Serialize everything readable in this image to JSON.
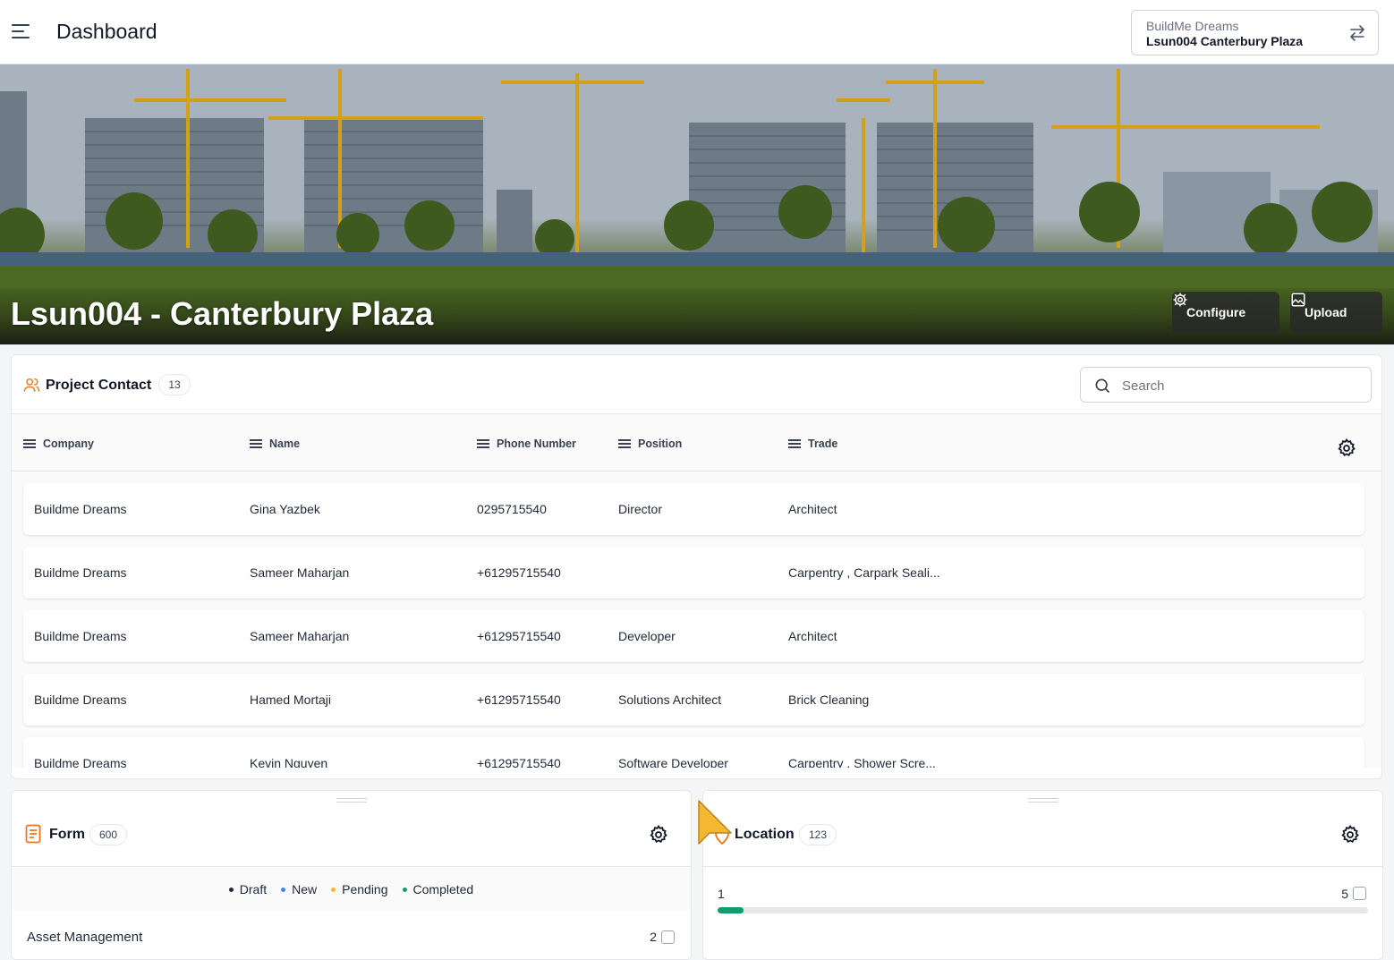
{
  "header": {
    "title": "Dashboard",
    "project_switcher": {
      "organization": "BuildMe Dreams",
      "project": "Lsun004 Canterbury Plaza"
    }
  },
  "banner": {
    "title": "Lsun004 - Canterbury Plaza",
    "configure_label": "Configure",
    "upload_label": "Upload"
  },
  "contacts": {
    "title": "Project Contact",
    "count": "13",
    "search_placeholder": "Search",
    "columns": [
      "Company",
      "Name",
      "Phone Number",
      "Position",
      "Trade"
    ],
    "rows": [
      {
        "company": "Buildme Dreams",
        "name": "Gina Yazbek",
        "phone": "0295715540",
        "position": "Director",
        "trade": "Architect"
      },
      {
        "company": "Buildme Dreams",
        "name": "Sameer Maharjan",
        "phone": "+61295715540",
        "position": "",
        "trade": "Carpentry , Carpark Seali..."
      },
      {
        "company": "Buildme Dreams",
        "name": "Sameer Maharjan",
        "phone": "+61295715540",
        "position": "Developer",
        "trade": "Architect"
      },
      {
        "company": "Buildme Dreams",
        "name": "Hamed Mortaji",
        "phone": "+61295715540",
        "position": "Solutions Architect",
        "trade": "Brick Cleaning"
      },
      {
        "company": "Buildme Dreams",
        "name": "Kevin Nguyen",
        "phone": "+61295715540",
        "position": "Software Developer",
        "trade": "Carpentry , Shower Scre..."
      }
    ]
  },
  "form_widget": {
    "title": "Form",
    "count": "600",
    "legend": [
      {
        "label": "Draft",
        "color": "#1f2937"
      },
      {
        "label": "New",
        "color": "#3b82f6"
      },
      {
        "label": "Pending",
        "color": "#f5b731"
      },
      {
        "label": "Completed",
        "color": "#0f9d6b"
      }
    ],
    "row": {
      "label": "Asset Management",
      "count": "2"
    }
  },
  "location_widget": {
    "title": "Location",
    "count": "123",
    "row": {
      "label": "1",
      "count": "5",
      "progress": 0.04
    }
  },
  "colors": {
    "accent": "#f97316",
    "progress": "#0f9d6b",
    "cursor": "#f5b731"
  }
}
